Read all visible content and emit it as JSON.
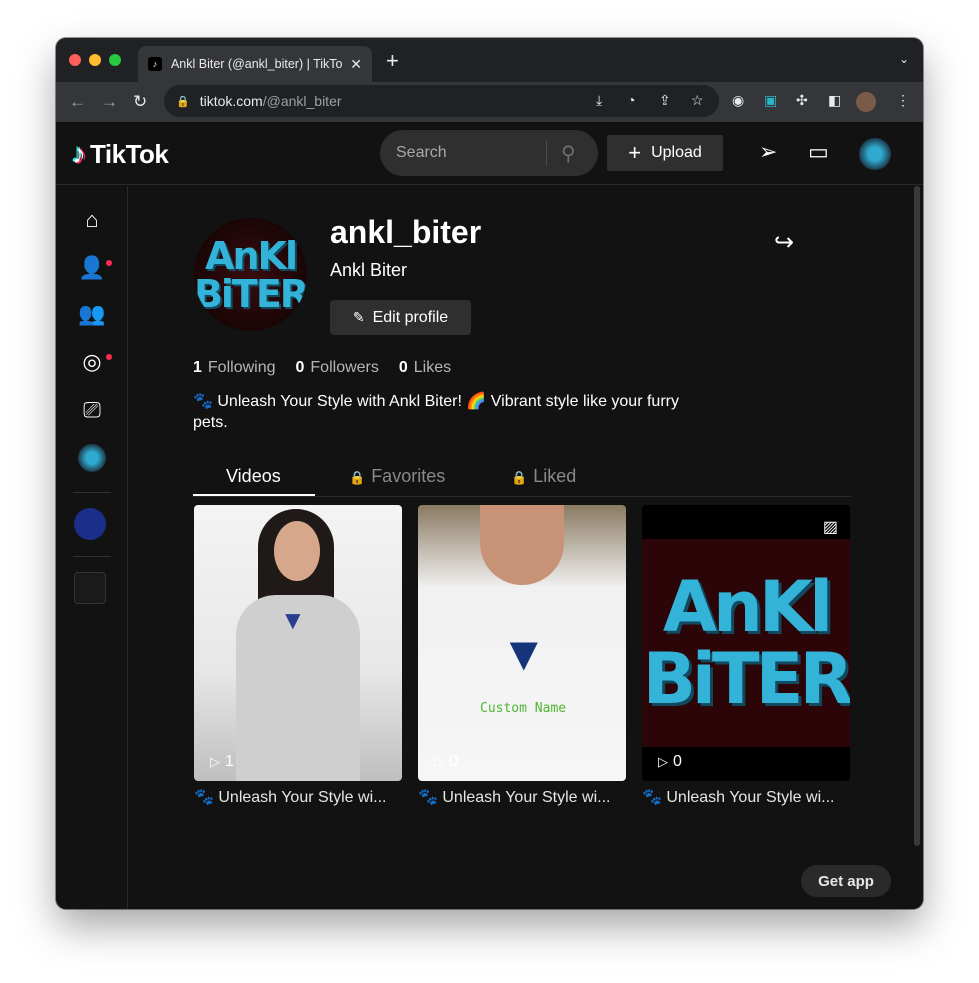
{
  "browser": {
    "tab_title": "Ankl Biter (@ankl_biter) | TikTok",
    "url_host": "tiktok.com",
    "url_path": "/@ankl_biter"
  },
  "header": {
    "logo_text": "TikTok",
    "search_placeholder": "Search",
    "upload_label": "Upload"
  },
  "profile": {
    "avatar_line1": "AnKl",
    "avatar_line2": "BiTER",
    "username": "ankl_biter",
    "nickname": "Ankl Biter",
    "edit_label": "Edit profile",
    "stats": [
      {
        "value": "1",
        "label": "Following"
      },
      {
        "value": "0",
        "label": "Followers"
      },
      {
        "value": "0",
        "label": "Likes"
      }
    ],
    "bio": "🐾 Unleash Your Style with Ankl Biter! 🌈 Vibrant style like your furry pets."
  },
  "tabs": {
    "videos": "Videos",
    "favorites": "Favorites",
    "liked": "Liked"
  },
  "videos": [
    {
      "views": "1",
      "caption": "🐾 Unleash Your Style wi..."
    },
    {
      "views": "0",
      "caption": "🐾 Unleash Your Style wi...",
      "overlay_text": "Custom Name"
    },
    {
      "views": "0",
      "caption": "🐾 Unleash Your Style wi...",
      "overlay_line1": "AnKl",
      "overlay_line2": "BiTER"
    }
  ],
  "get_app_label": "Get app"
}
